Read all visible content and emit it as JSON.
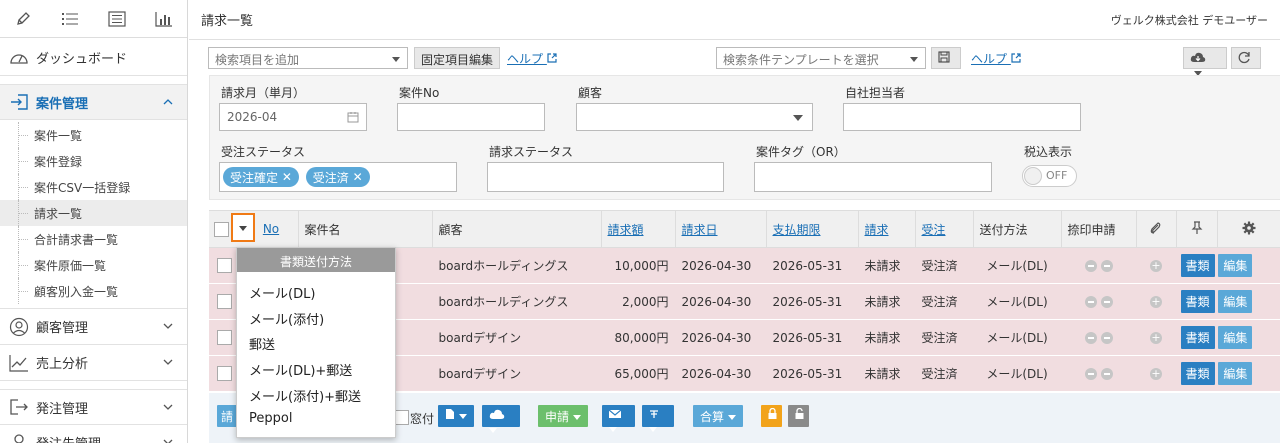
{
  "sidebar": {
    "top_icons": [
      "pencil-icon",
      "list-icon",
      "list-box-icon",
      "bar-chart-icon"
    ],
    "dashboard": "ダッシュボード",
    "project_mgmt": "案件管理",
    "sub_items": [
      "案件一覧",
      "案件登録",
      "案件CSV一括登録",
      "請求一覧",
      "合計請求書一覧",
      "案件原価一覧",
      "顧客別入金一覧"
    ],
    "customer_mgmt": "顧客管理",
    "sales_analysis": "売上分析",
    "order_mgmt": "発注管理",
    "supplier_mgmt": "発注先管理"
  },
  "header": {
    "title": "請求一覧",
    "company": "ヴェルク株式会社 デモユーザー"
  },
  "searchbar": {
    "add_search_placeholder": "検索項目を追加",
    "fixed_edit": "固定項目編集",
    "help": "ヘルプ",
    "template_placeholder": "検索条件テンプレートを選択",
    "help2": "ヘルプ"
  },
  "filters": {
    "billing_month_label": "請求月（単月）",
    "billing_month_value": "2026-04",
    "project_no_label": "案件No",
    "customer_label": "顧客",
    "assignee_label": "自社担当者",
    "order_status_label": "受注ステータス",
    "order_status_tags": [
      "受注確定",
      "受注済"
    ],
    "billing_status_label": "請求ステータス",
    "project_tag_label": "案件タグ（OR）",
    "tax_label": "税込表示",
    "tax_toggle": "OFF"
  },
  "table": {
    "headers": {
      "no": "No",
      "project": "案件名",
      "customer": "顧客",
      "amount": "請求額",
      "bill_date": "請求日",
      "due": "支払期限",
      "billing": "請求",
      "order": "受注",
      "send_method": "送付方法",
      "approval": "捺印申請"
    },
    "rows": [
      {
        "customer": "boardホールディングス",
        "amount": "10,000円",
        "bill_date": "2026-04-30",
        "due": "2026-05-31",
        "billing": "未請求",
        "order": "受注済",
        "send": "メール(DL)",
        "doc": "書類",
        "edit": "編集"
      },
      {
        "customer": "boardホールディングス",
        "amount": "2,000円",
        "bill_date": "2026-04-30",
        "due": "2026-05-31",
        "billing": "未請求",
        "order": "受注済",
        "send": "メール(DL)",
        "doc": "書類",
        "edit": "編集"
      },
      {
        "customer": "boardデザイン",
        "amount": "80,000円",
        "bill_date": "2026-04-30",
        "due": "2026-05-31",
        "billing": "未請求",
        "order": "受注済",
        "send": "メール(DL)",
        "doc": "書類",
        "edit": "編集"
      },
      {
        "customer": "boardデザイン",
        "amount": "65,000円",
        "bill_date": "2026-04-30",
        "due": "2026-05-31",
        "billing": "未請求",
        "order": "受注済",
        "send": "メール(DL)",
        "doc": "書類",
        "edit": "編集"
      }
    ]
  },
  "footer": {
    "partial_btn": "請",
    "window_label": "窓付",
    "apply": "申請",
    "total": "合算"
  },
  "popup": {
    "header": "書類送付方法",
    "items": [
      "メール(DL)",
      "メール(添付)",
      "郵送",
      "メール(DL)+郵送",
      "メール(添付)+郵送",
      "Peppol"
    ]
  },
  "colors": {
    "accent": "#1a6fb5",
    "row_bg": "#f1dde0",
    "highlight": "#f07a15",
    "doc_btn": "#2a7fc2",
    "edit_btn": "#5aa8d8"
  }
}
